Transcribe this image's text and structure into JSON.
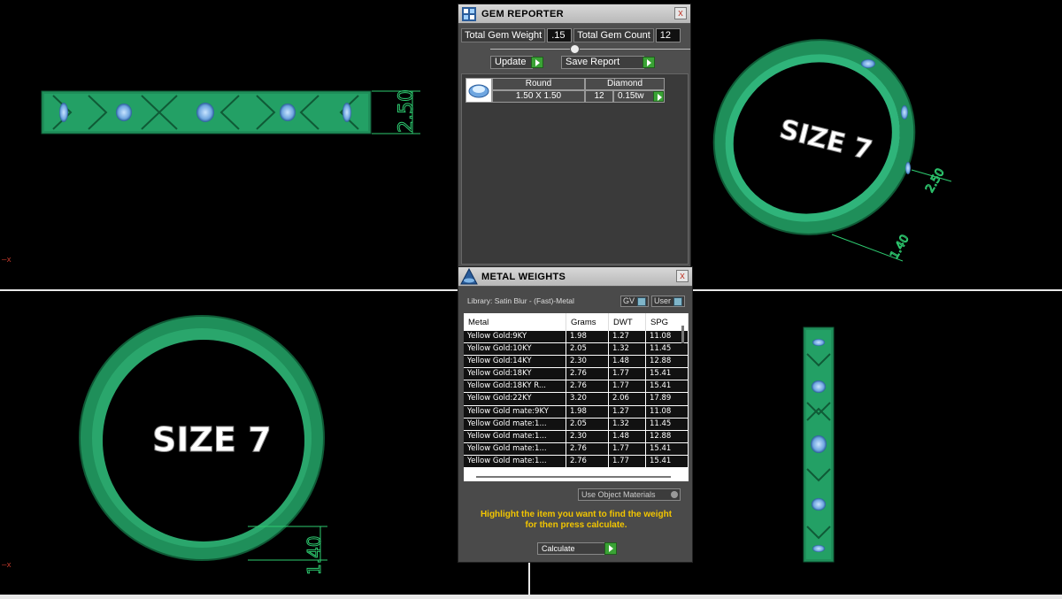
{
  "gem_reporter": {
    "title": "GEM REPORTER",
    "close": "x",
    "total_gem_weight_label": "Total Gem Weight",
    "total_gem_weight_value": ".15",
    "total_gem_count_label": "Total Gem Count",
    "total_gem_count_value": "12",
    "update_label": "Update",
    "save_report_label": "Save Report",
    "gems": [
      {
        "shape": "Round",
        "type": "Diamond",
        "size": "1.50 X 1.50",
        "count": "12",
        "weight": "0.15tw"
      }
    ]
  },
  "metal_weights": {
    "title": "METAL WEIGHTS",
    "close": "x",
    "library": "Library: Satin Blur - (Fast)-Metal",
    "gv_label": "GV",
    "user_label": "User",
    "columns": [
      "Metal",
      "Grams",
      "DWT",
      "SPG"
    ],
    "rows": [
      [
        "Yellow Gold:9KY",
        "1.98",
        "1.27",
        "11.08"
      ],
      [
        "Yellow Gold:10KY",
        "2.05",
        "1.32",
        "11.45"
      ],
      [
        "Yellow Gold:14KY",
        "2.30",
        "1.48",
        "12.88"
      ],
      [
        "Yellow Gold:18KY",
        "2.76",
        "1.77",
        "15.41"
      ],
      [
        "Yellow Gold:18KY R...",
        "2.76",
        "1.77",
        "15.41"
      ],
      [
        "Yellow Gold:22KY",
        "3.20",
        "2.06",
        "17.89"
      ],
      [
        "Yellow Gold mate:9KY",
        "1.98",
        "1.27",
        "11.08"
      ],
      [
        "Yellow Gold mate:1...",
        "2.05",
        "1.32",
        "11.45"
      ],
      [
        "Yellow Gold mate:1...",
        "2.30",
        "1.48",
        "12.88"
      ],
      [
        "Yellow Gold mate:1...",
        "2.76",
        "1.77",
        "15.41"
      ],
      [
        "Yellow Gold mate:1...",
        "2.76",
        "1.77",
        "15.41"
      ]
    ],
    "use_object_materials": "Use Object Materials",
    "hint_line1": "Highlight the item you want to find the weight",
    "hint_line2": "for then press calculate.",
    "calculate_label": "Calculate"
  },
  "viewports": {
    "top_left": {
      "dimension": "2.50",
      "axis": "x"
    },
    "top_right": {
      "engraving": "SIZE 7",
      "dim_a": "2.50",
      "dim_b": "1.40"
    },
    "bottom_left": {
      "engraving": "SIZE 7",
      "dimension": "1.40",
      "axis": "x"
    },
    "bottom_right": {}
  },
  "colors": {
    "ring_green": "#1f8f5a",
    "ring_green_light": "#2fb47a",
    "gem_blue": "#7eb6e8",
    "hint_yellow": "#f2c500"
  }
}
